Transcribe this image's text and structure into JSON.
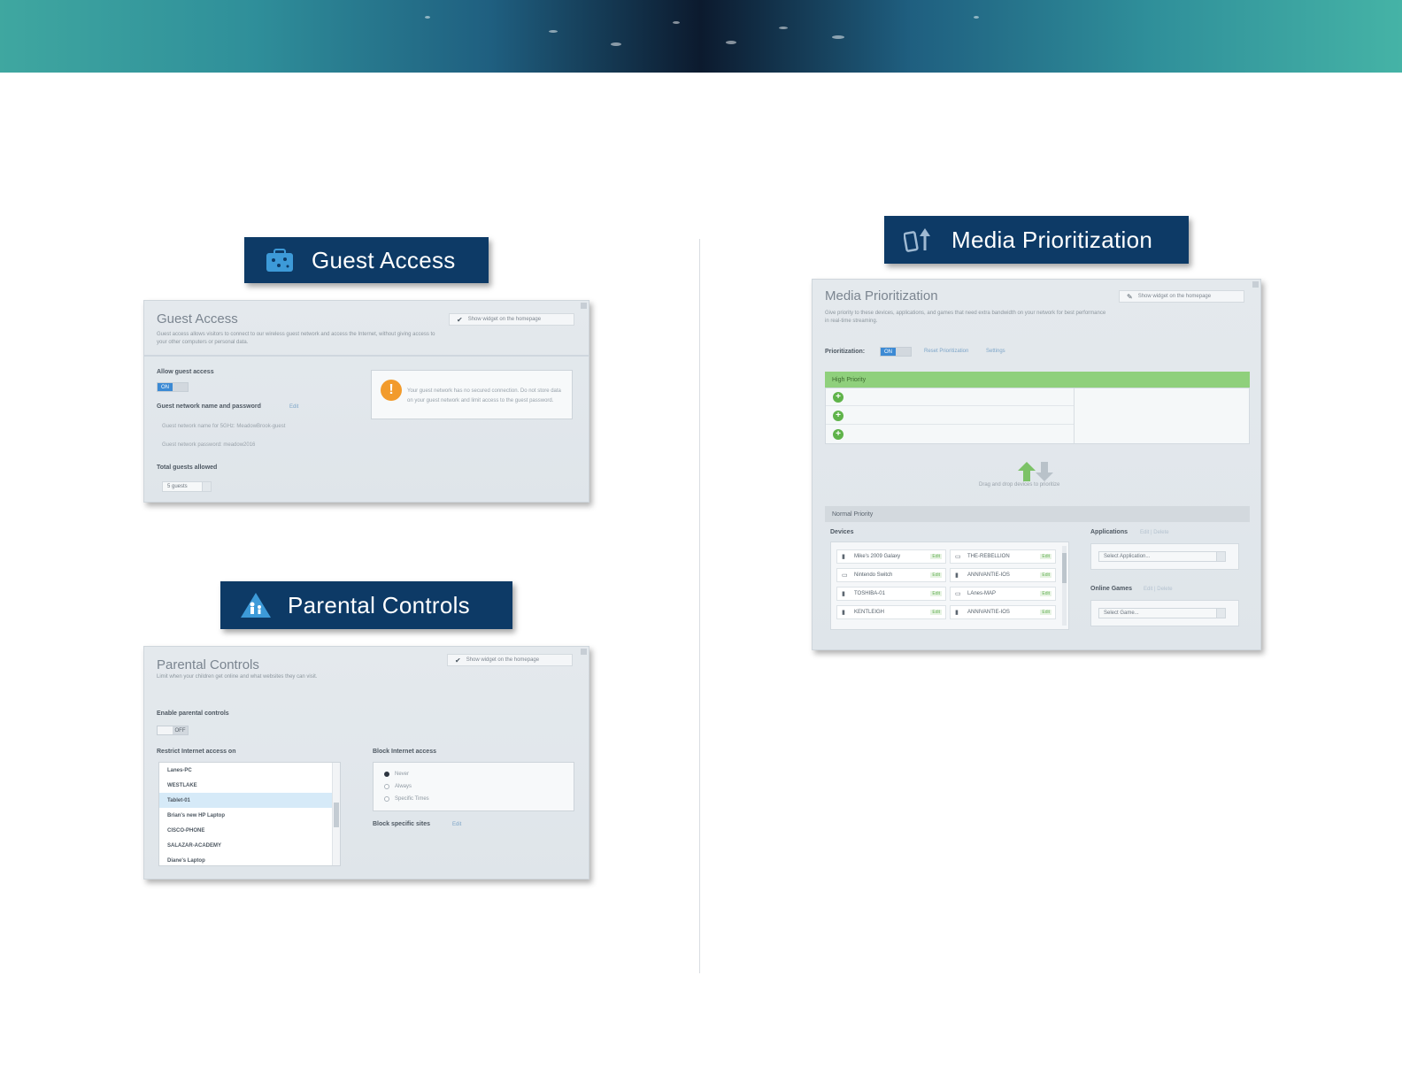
{
  "colors": {
    "label_bg": "#0d3a66",
    "toggle_on": "#3c8ad4",
    "high_priority": "#8fd07c",
    "warning": "#f29b2c"
  },
  "guest_access": {
    "label": "Guest Access",
    "icon": "guest-access-icon",
    "panel": {
      "title": "Guest Access",
      "widget_button": "Show widget on the homepage",
      "description": "Guest access allows visitors to connect to our wireless guest network and access the Internet, without giving access to your other computers or personal data.",
      "allow_label": "Allow guest access",
      "toggle_on": "ON",
      "network_label": "Guest network name and password",
      "edit_link": "Edit",
      "network_name": "Guest network name for 5GHz:   MeadowBrook-guest",
      "network_password": "Guest network password:   meadow2016",
      "total_label": "Total guests allowed",
      "total_value": "5 guests",
      "notice": "Your guest network has no secured connection. Do not store data on your guest network and limit access to the guest password."
    }
  },
  "parental_controls": {
    "label": "Parental Controls",
    "icon": "parental-controls-icon",
    "panel": {
      "title": "Parental Controls",
      "widget_button": "Show widget on the homepage",
      "description": "Limit when your children get online and what websites they can visit.",
      "enable_label": "Enable parental controls",
      "toggle_off": "OFF",
      "restrict_label": "Restrict Internet access on",
      "devices": [
        "Lanes-PC",
        "WESTLAKE",
        "Tablet-01",
        "Brian's new HP Laptop",
        "CISCO-PHONE",
        "SALAZAR-ACADEMY",
        "Diane's Laptop"
      ],
      "block_label": "Block Internet access",
      "radio_options": [
        "Never",
        "Always",
        "Specific Times"
      ],
      "block_sites_label": "Block specific sites",
      "block_sites_link": "Edit"
    }
  },
  "media_prioritization": {
    "label": "Media Prioritization",
    "icon": "media-prioritization-icon",
    "panel": {
      "title": "Media Prioritization",
      "widget_button": "Show widget on the homepage",
      "description": "Give priority to these devices, applications, and games that need extra bandwidth on your network for best performance in real-time streaming.",
      "prioritization_label": "Prioritization:",
      "toggle_on": "ON",
      "reset_link": "Reset Prioritization",
      "settings_link": "Settings",
      "high_priority": "High Priority",
      "drag_hint": "Drag and drop devices to prioritize",
      "normal_priority": "Normal Priority",
      "devices_label": "Devices",
      "devices": [
        [
          "Mike's 2009 Galaxy",
          "THE-REBELLION"
        ],
        [
          "Nintendo Switch",
          "ANNIVANTIE-IOS"
        ],
        [
          "TOSHIBA-01",
          "LAnes-MAP"
        ],
        [
          "KENTLEIGH",
          "ANNIVANTIE-IOS"
        ]
      ],
      "device_tag": "Edit",
      "applications_label": "Applications",
      "applications_links": "Edit  |  Delete",
      "applications_select": "Select Application...",
      "games_label": "Online Games",
      "games_links": "Edit  |  Delete",
      "games_select": "Select Game..."
    }
  }
}
